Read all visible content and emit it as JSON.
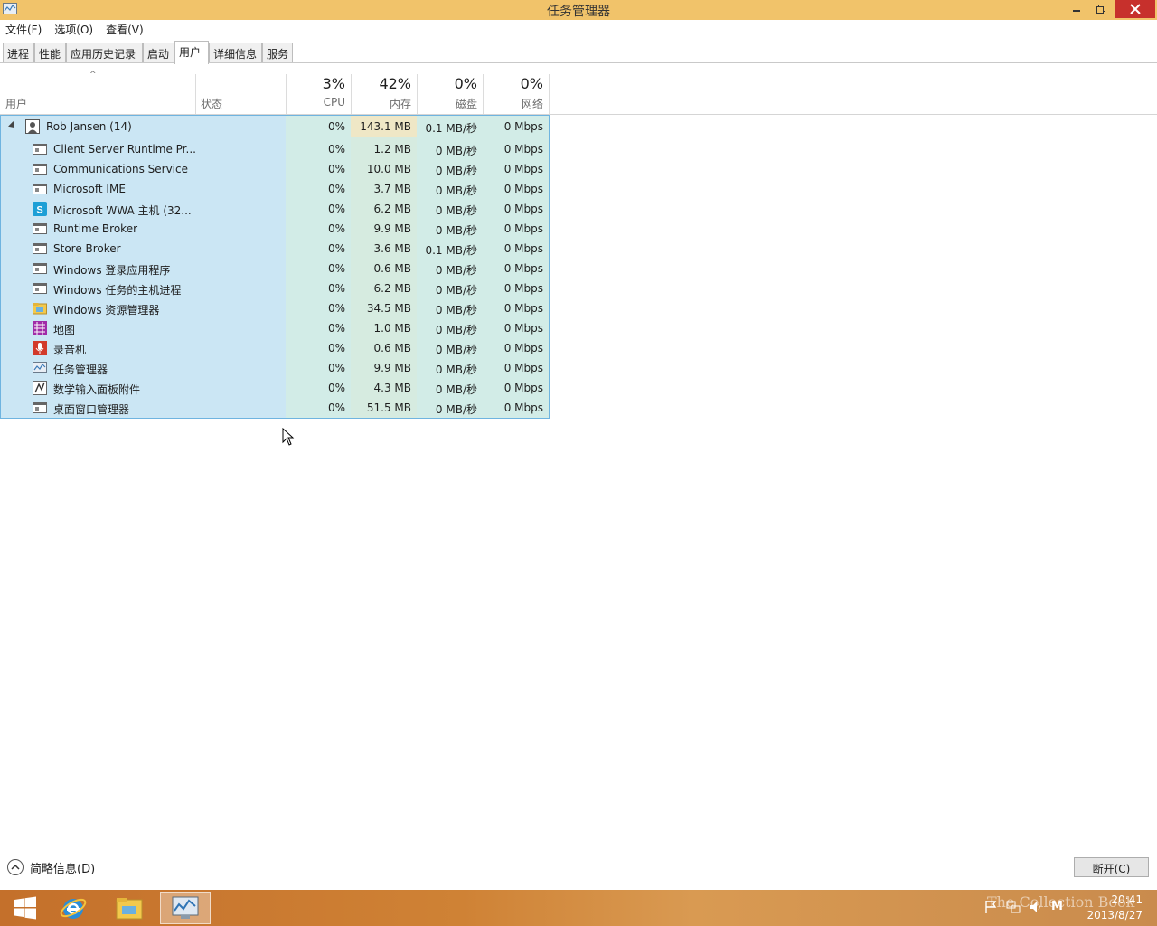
{
  "window": {
    "title": "任务管理器"
  },
  "menu": [
    "文件(F)",
    "选项(O)",
    "查看(V)"
  ],
  "tabs": [
    "进程",
    "性能",
    "应用历史记录",
    "启动",
    "用户",
    "详细信息",
    "服务"
  ],
  "active_tab": "用户",
  "columns": {
    "user": "用户",
    "status": "状态",
    "cpu": {
      "pct": "3%",
      "label": "CPU"
    },
    "memory": {
      "pct": "42%",
      "label": "内存"
    },
    "disk": {
      "pct": "0%",
      "label": "磁盘"
    },
    "network": {
      "pct": "0%",
      "label": "网络"
    }
  },
  "user_row": {
    "name": "Rob Jansen (14)",
    "cpu": "0%",
    "memory": "143.1 MB",
    "disk": "0.1 MB/秒",
    "network": "0 Mbps"
  },
  "processes": [
    {
      "name": "Client Server Runtime Pr...",
      "icon": "window-icon",
      "cpu": "0%",
      "memory": "1.2 MB",
      "disk": "0 MB/秒",
      "network": "0 Mbps"
    },
    {
      "name": "Communications Service",
      "icon": "window-icon",
      "cpu": "0%",
      "memory": "10.0 MB",
      "disk": "0 MB/秒",
      "network": "0 Mbps"
    },
    {
      "name": "Microsoft IME",
      "icon": "window-icon",
      "cpu": "0%",
      "memory": "3.7 MB",
      "disk": "0 MB/秒",
      "network": "0 Mbps"
    },
    {
      "name": "Microsoft WWA 主机 (32...",
      "icon": "skype-icon",
      "cpu": "0%",
      "memory": "6.2 MB",
      "disk": "0 MB/秒",
      "network": "0 Mbps"
    },
    {
      "name": "Runtime Broker",
      "icon": "window-icon",
      "cpu": "0%",
      "memory": "9.9 MB",
      "disk": "0 MB/秒",
      "network": "0 Mbps"
    },
    {
      "name": "Store Broker",
      "icon": "window-icon",
      "cpu": "0%",
      "memory": "3.6 MB",
      "disk": "0.1 MB/秒",
      "network": "0 Mbps"
    },
    {
      "name": "Windows 登录应用程序",
      "icon": "window-icon",
      "cpu": "0%",
      "memory": "0.6 MB",
      "disk": "0 MB/秒",
      "network": "0 Mbps"
    },
    {
      "name": "Windows 任务的主机进程",
      "icon": "window-icon",
      "cpu": "0%",
      "memory": "6.2 MB",
      "disk": "0 MB/秒",
      "network": "0 Mbps"
    },
    {
      "name": "Windows 资源管理器",
      "icon": "folder-icon",
      "cpu": "0%",
      "memory": "34.5 MB",
      "disk": "0 MB/秒",
      "network": "0 Mbps"
    },
    {
      "name": "地图",
      "icon": "maps-icon",
      "cpu": "0%",
      "memory": "1.0 MB",
      "disk": "0 MB/秒",
      "network": "0 Mbps"
    },
    {
      "name": "录音机",
      "icon": "microphone-icon",
      "cpu": "0%",
      "memory": "0.6 MB",
      "disk": "0 MB/秒",
      "network": "0 Mbps"
    },
    {
      "name": "任务管理器",
      "icon": "task-manager-icon",
      "cpu": "0%",
      "memory": "9.9 MB",
      "disk": "0 MB/秒",
      "network": "0 Mbps"
    },
    {
      "name": "数学输入面板附件",
      "icon": "math-input-icon",
      "cpu": "0%",
      "memory": "4.3 MB",
      "disk": "0 MB/秒",
      "network": "0 Mbps"
    },
    {
      "name": "桌面窗口管理器",
      "icon": "window-icon",
      "cpu": "0%",
      "memory": "51.5 MB",
      "disk": "0 MB/秒",
      "network": "0 Mbps"
    }
  ],
  "footer": {
    "fewer_details": "简略信息(D)",
    "disconnect": "断开(C)"
  },
  "taskbar": {
    "clock_time": "20:41",
    "clock_date": "2013/8/27",
    "watermark": "The Collection Book",
    "ime": "M"
  },
  "colors": {
    "titlebar": "#f1c36a",
    "selection": "#cbe6f4",
    "close": "#c7302c"
  }
}
